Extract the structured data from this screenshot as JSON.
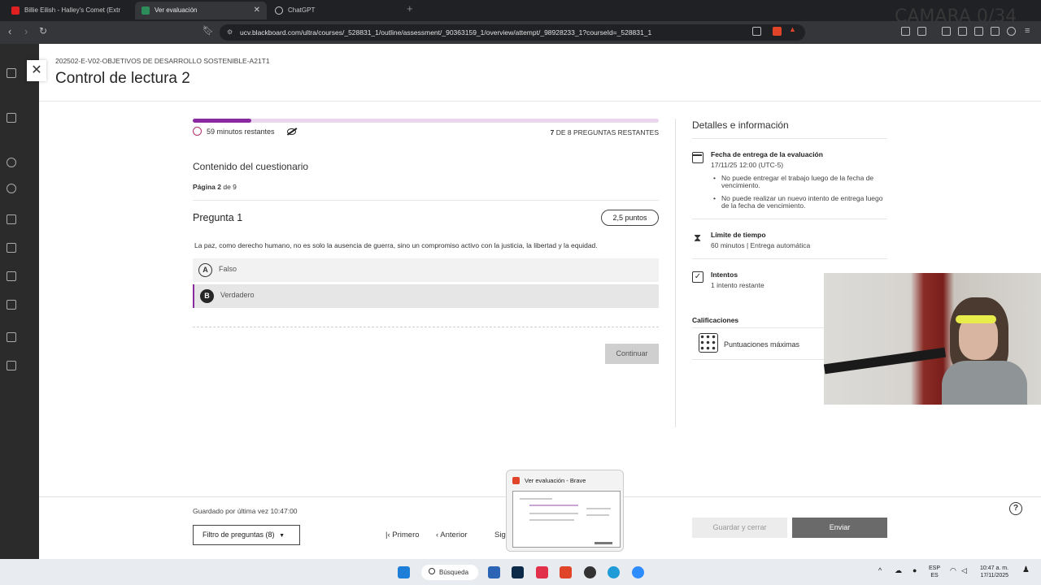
{
  "browser": {
    "tabs": [
      {
        "title": "Billie Eilish - Halley's Comet (Extr",
        "active": false
      },
      {
        "title": "Ver evaluación",
        "active": true
      },
      {
        "title": "ChatGPT",
        "active": false
      }
    ],
    "url": "ucv.blackboard.com/ultra/courses/_528831_1/outline/assessment/_90363159_1/overview/attempt/_98928233_1?courseId=_528831_1",
    "overlay_text": "CAMARA 0/34"
  },
  "header": {
    "course_code": "202502-E-V02-OBJETIVOS DE DESARROLLO SOSTENIBLE-A21T1",
    "title": "Control de lectura 2"
  },
  "quiz": {
    "progress": 0.125,
    "time_remaining": "59 minutos restantes",
    "questions_remaining_count": "7",
    "questions_remaining_text": "DE 8 PREGUNTAS RESTANTES",
    "content_heading": "Contenido del cuestionario",
    "page_label": "Página 2",
    "page_of": "de 9",
    "question_title": "Pregunta 1",
    "points": "2,5 puntos",
    "question_text": "La paz, como derecho humano, no es solo la ausencia de guerra, sino un compromiso activo con la justicia, la libertad y la equidad.",
    "options": [
      {
        "letter": "A",
        "label": "Falso",
        "selected": false
      },
      {
        "letter": "B",
        "label": "Verdadero",
        "selected": true
      }
    ],
    "continue_label": "Continuar"
  },
  "details": {
    "title": "Detalles e información",
    "due_heading": "Fecha de entrega de la evaluación",
    "due_date": "17/11/25 12:00 (UTC-5)",
    "due_notes": [
      "No puede entregar el trabajo luego de la fecha de vencimiento.",
      "No puede realizar un nuevo intento de entrega luego de la fecha de vencimiento."
    ],
    "time_limit_heading": "Límite de tiempo",
    "time_limit_value": "60 minutos | Entrega automática",
    "attempts_heading": "Intentos",
    "attempts_value": "1 intento restante",
    "grades_heading": "Calificaciones",
    "grades_label": "Puntuaciones máximas"
  },
  "footer": {
    "saved_text": "Guardado por última vez 10:47:00",
    "filter_label": "Filtro de preguntas (8)",
    "first_label": "Primero",
    "previous_label": "Anterior",
    "next_label": "Sig",
    "save_close_label": "Guardar y cerrar",
    "submit_label": "Enviar"
  },
  "preview": {
    "title": "Ver evaluación - Brave"
  },
  "taskbar": {
    "search_label": "Búsqueda",
    "lang_top": "ESP",
    "lang_bottom": "ES",
    "time": "10:47 a. m.",
    "date": "17/11/2025"
  },
  "colors": {
    "accent": "#8a2aa0",
    "progress_track": "#ebd6ee",
    "submit_bg": "#6a6a6a"
  }
}
